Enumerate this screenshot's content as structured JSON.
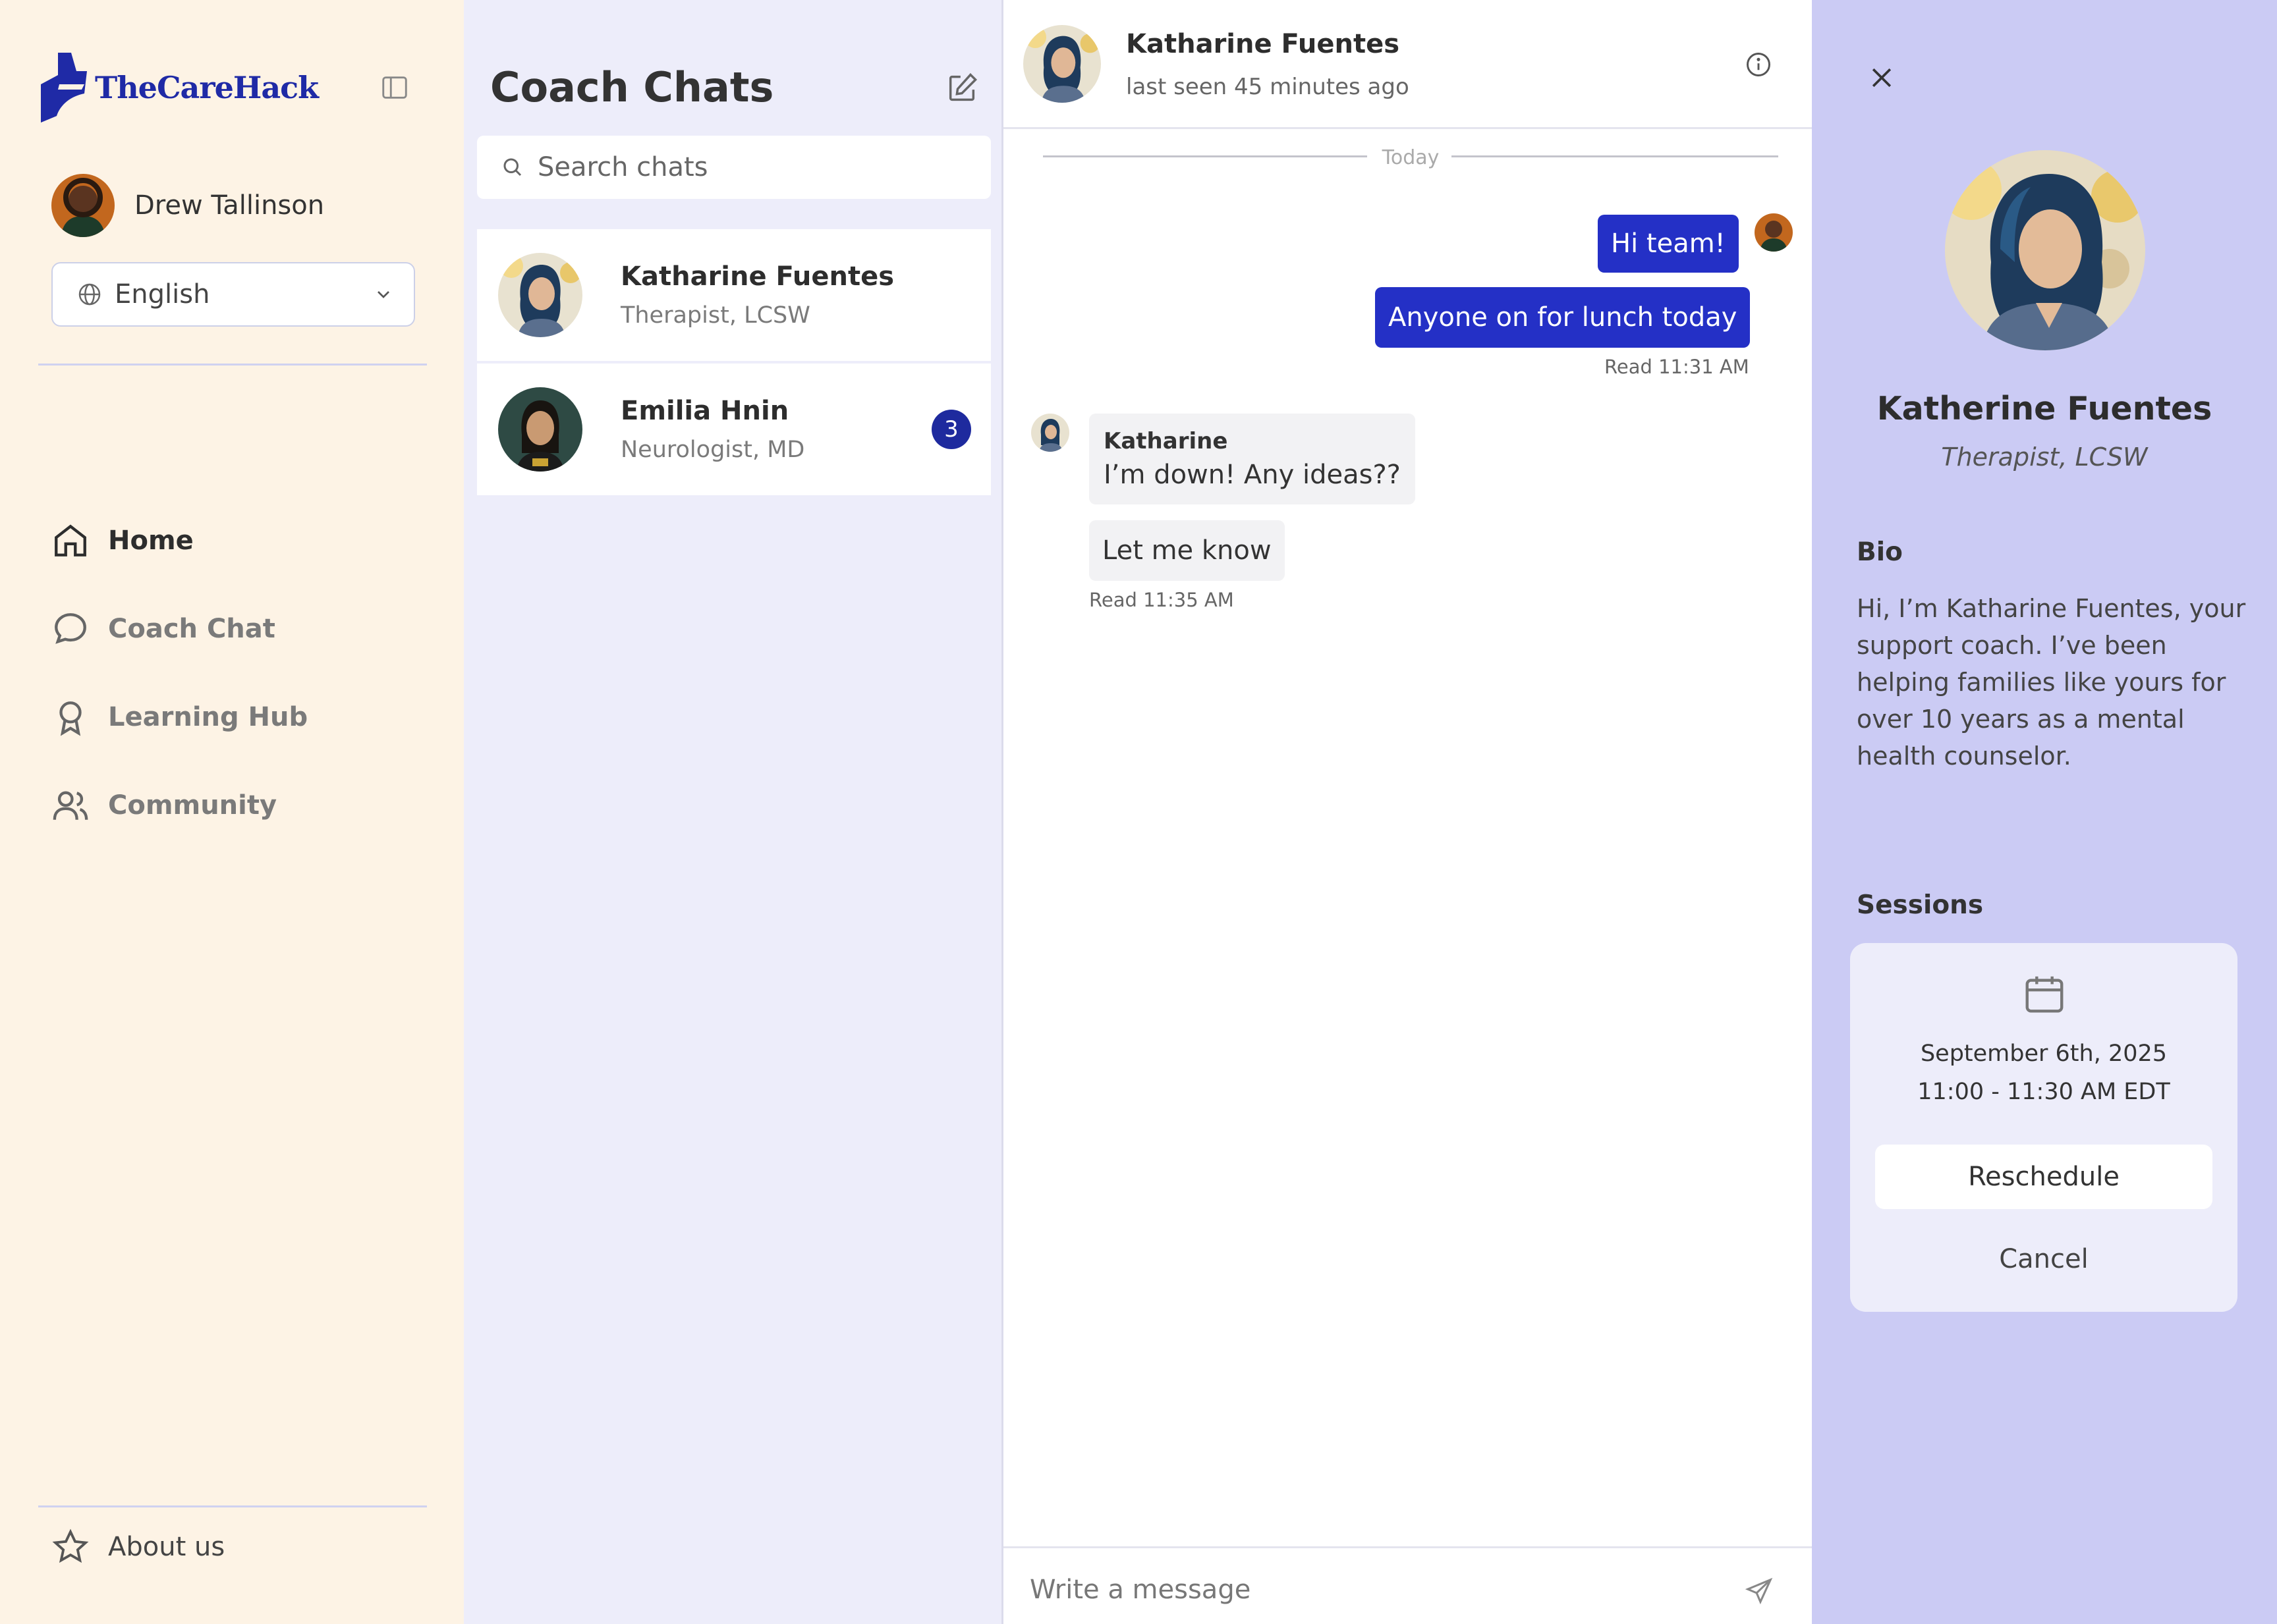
{
  "app": {
    "brand": "TheCareHack"
  },
  "sidebar": {
    "user_name": "Drew Tallinson",
    "language": "English",
    "nav": [
      {
        "label": "Home",
        "icon": "home-icon",
        "active": true
      },
      {
        "label": "Coach Chat",
        "icon": "chat-bubble-icon",
        "active": false
      },
      {
        "label": "Learning Hub",
        "icon": "award-icon",
        "active": false
      },
      {
        "label": "Community",
        "icon": "users-icon",
        "active": false
      }
    ],
    "about": "About us"
  },
  "chatlist": {
    "title": "Coach Chats",
    "search_placeholder": "Search chats",
    "contacts": [
      {
        "name": "Katharine Fuentes",
        "role": "Therapist, LCSW",
        "unread": ""
      },
      {
        "name": "Emilia Hnin",
        "role": "Neurologist, MD",
        "unread": "3"
      }
    ]
  },
  "conversation": {
    "name": "Katharine Fuentes",
    "last_seen": "last seen 45 minutes ago",
    "day_separator": "Today",
    "messages": [
      {
        "direction": "out",
        "text": "Hi team!"
      },
      {
        "direction": "out",
        "text": "Anyone on for lunch today",
        "meta": "Read 11:31 AM"
      },
      {
        "direction": "in",
        "sender": "Katharine",
        "text": "I’m down! Any ideas??"
      },
      {
        "direction": "in",
        "text": "Let me know",
        "meta": "Read 11:35 AM"
      }
    ],
    "composer_placeholder": "Write a message"
  },
  "profile": {
    "name": "Katherine Fuentes",
    "role": "Therapist, LCSW",
    "bio_heading": "Bio",
    "bio": "Hi, I’m Katharine Fuentes, your support coach. I’ve been helping families like yours for over 10 years as a mental health counselor.",
    "sessions_heading": "Sessions",
    "session": {
      "date": "September 6th, 2025",
      "time": "11:00 - 11:30 AM EDT",
      "reschedule": "Reschedule",
      "cancel": "Cancel"
    }
  },
  "colors": {
    "sidebar_bg": "#fdf3e5",
    "chatlist_bg": "#ededfa",
    "profile_bg": "#cbcbf4",
    "brand": "#1f2aa6",
    "outgoing_bubble": "#2430c6",
    "badge": "#1e2a9e"
  }
}
